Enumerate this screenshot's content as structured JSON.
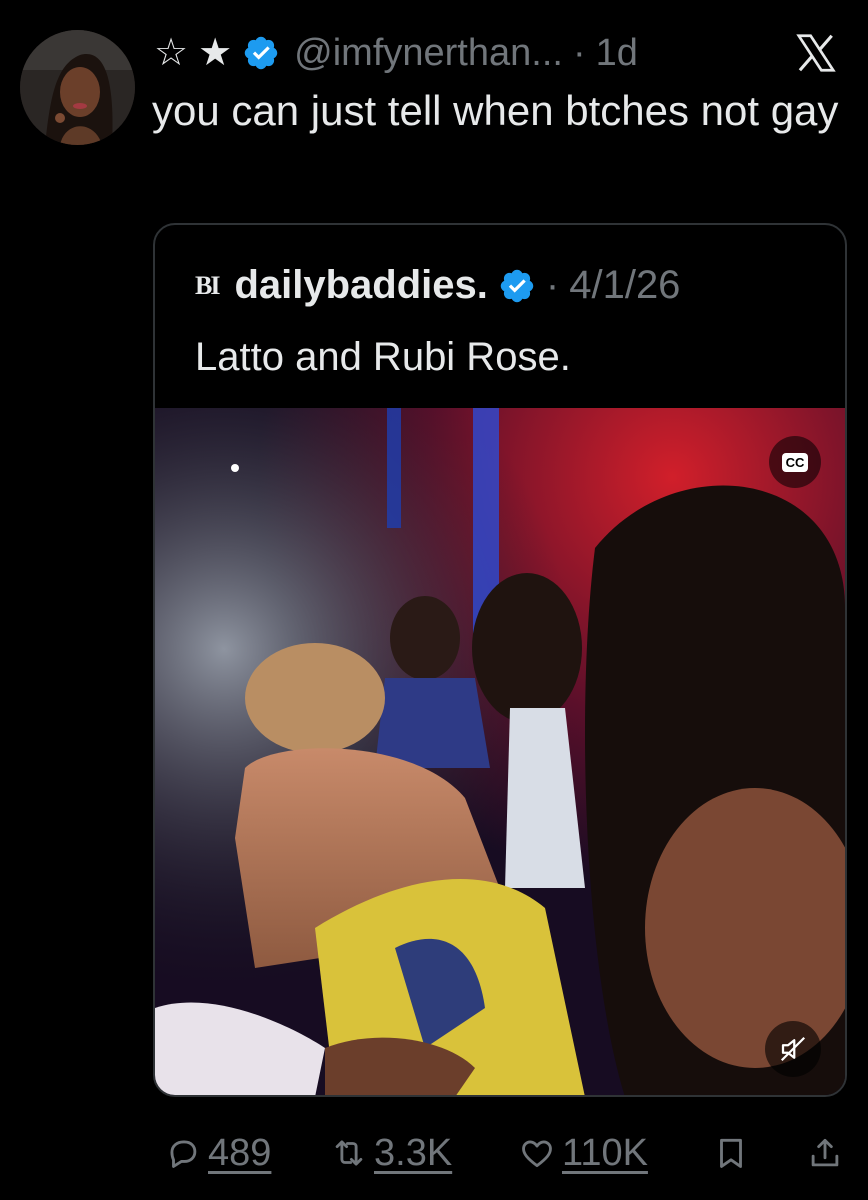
{
  "tweet": {
    "stars": [
      "☆",
      "★"
    ],
    "handle": "@imfynerthan...",
    "separator": "·",
    "time": "1d",
    "text": "you can just tell when btches not gay"
  },
  "quote": {
    "logo_text": "BI",
    "name": "dailybaddies.",
    "separator": "·",
    "date": "4/1/26",
    "text": "Latto and Rubi Rose.",
    "cc_label": "CC"
  },
  "actions": {
    "replies": "489",
    "reposts": "3.3K",
    "likes": "110K"
  },
  "colors": {
    "verified": "#1d9bf0",
    "muted_text": "#71767b",
    "text": "#e7e9ea"
  }
}
